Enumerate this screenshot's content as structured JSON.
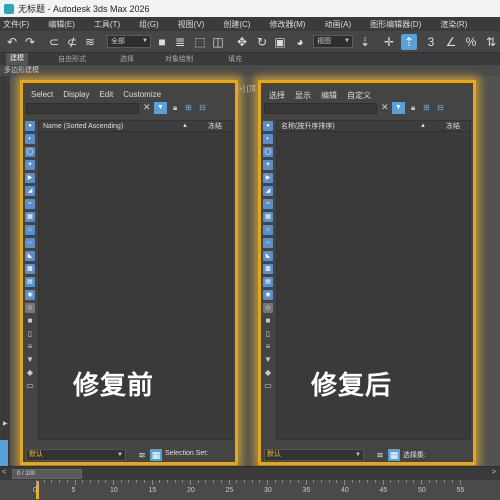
{
  "window": {
    "title": "无标题 - Autodesk 3ds Max 2026"
  },
  "menu": [
    "文件(F)",
    "编辑(E)",
    "工具(T)",
    "组(G)",
    "视图(V)",
    "创建(C)",
    "修改器(M)",
    "动画(A)",
    "图形编辑器(D)",
    "渲染(R)"
  ],
  "toolbar": {
    "selection_filter": "全部",
    "reference_coord": "视图"
  },
  "ribbon": {
    "tabs": [
      "建模",
      "自由形式",
      "选择",
      "对象绘制",
      "填充"
    ],
    "active": "建模",
    "subtitle": "多边形建模"
  },
  "viewport": {
    "label": "[+] [顶"
  },
  "left_panel": {
    "menu": [
      "Select",
      "Display",
      "Edit",
      "Customize"
    ],
    "column_name": "Name (Sorted Ascending)",
    "column_frozen": "冻结",
    "caption": "修复前",
    "layer": "默认",
    "selection_set": "Selection Set:"
  },
  "right_panel": {
    "menu": [
      "选择",
      "显示",
      "编辑",
      "自定义"
    ],
    "column_name": "名称(按升序排序)",
    "column_frozen": "冻结",
    "caption": "修复后",
    "layer": "默认",
    "selection_set": "选择集:"
  },
  "timeline": {
    "frame": "0 / 100",
    "left_arrow": "<",
    "right_arrow": ">"
  },
  "ruler": {
    "labels": [
      "0",
      "5",
      "10",
      "15",
      "20",
      "25",
      "30",
      "35",
      "40",
      "45",
      "50",
      "55"
    ]
  },
  "colors": {
    "highlight": "#e0a820",
    "accent": "#5aa0d8",
    "layer_text": "#e8c13c"
  }
}
